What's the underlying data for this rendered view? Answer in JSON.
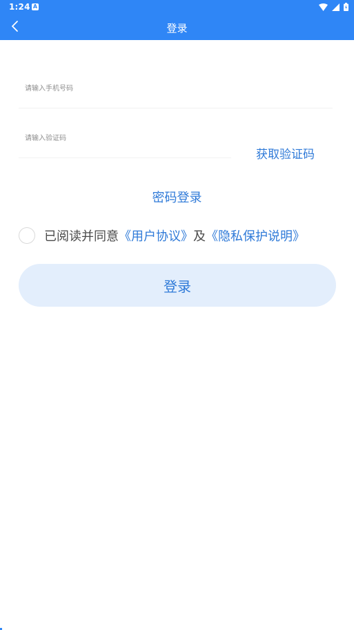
{
  "status_bar": {
    "time": "1:24",
    "notification_icon_letter": "A",
    "icons": [
      "wifi-icon",
      "signal-icon",
      "battery-icon"
    ],
    "background_color": "#2f86f6"
  },
  "toolbar": {
    "title": "登录",
    "back_icon": "chevron-left-icon",
    "background_color": "#2f86f6"
  },
  "form": {
    "phone_placeholder": "请输入手机号码",
    "phone_value": "",
    "code_placeholder": "请输入验证码",
    "code_value": "",
    "get_code_label": "获取验证码",
    "password_login_label": "密码登录"
  },
  "agreement": {
    "checked": false,
    "prefix": "已阅读并同意",
    "user_agreement": "《用户协议》",
    "conjunction": "及",
    "privacy_policy": "《隐私保护说明》"
  },
  "login_button": {
    "label": "登录",
    "background_color": "#e3eefc",
    "text_color": "#2f7ad8"
  },
  "colors": {
    "accent": "#2f7ad8",
    "primary": "#2f86f6"
  }
}
